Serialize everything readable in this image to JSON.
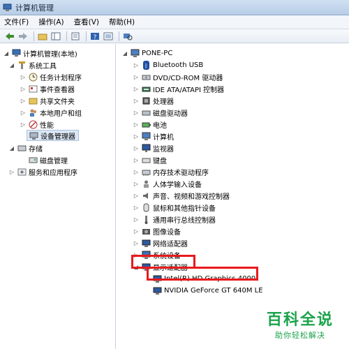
{
  "window": {
    "title": "计算机管理"
  },
  "menu": [
    "文件(F)",
    "操作(A)",
    "查看(V)",
    "帮助(H)"
  ],
  "left_tree": [
    {
      "label": "计算机管理(本地)",
      "level": 0,
      "expanded": true,
      "icon": "computer-management-icon"
    },
    {
      "label": "系统工具",
      "level": 1,
      "expanded": true,
      "icon": "tools-icon"
    },
    {
      "label": "任务计划程序",
      "level": 2,
      "expanded": false,
      "icon": "clock-icon"
    },
    {
      "label": "事件查看器",
      "level": 2,
      "expanded": false,
      "icon": "event-viewer-icon"
    },
    {
      "label": "共享文件夹",
      "level": 2,
      "expanded": false,
      "icon": "shared-folder-icon"
    },
    {
      "label": "本地用户和组",
      "level": 2,
      "expanded": false,
      "icon": "users-icon"
    },
    {
      "label": "性能",
      "level": 2,
      "expanded": false,
      "icon": "performance-icon"
    },
    {
      "label": "设备管理器",
      "level": 2,
      "selected": true,
      "icon": "device-manager-icon"
    },
    {
      "label": "存储",
      "level": 1,
      "expanded": true,
      "icon": "storage-icon"
    },
    {
      "label": "磁盘管理",
      "level": 2,
      "icon": "disk-management-icon"
    },
    {
      "label": "服务和应用程序",
      "level": 1,
      "expanded": false,
      "icon": "services-icon"
    }
  ],
  "right_tree": {
    "root": "PONE-PC",
    "categories": [
      {
        "label": "Bluetooth USB",
        "icon": "bluetooth-icon"
      },
      {
        "label": "DVD/CD-ROM 驱动器",
        "icon": "dvd-icon"
      },
      {
        "label": "IDE ATA/ATAPI 控制器",
        "icon": "ide-icon"
      },
      {
        "label": "处理器",
        "icon": "cpu-icon"
      },
      {
        "label": "磁盘驱动器",
        "icon": "disk-drive-icon"
      },
      {
        "label": "电池",
        "icon": "battery-icon"
      },
      {
        "label": "计算机",
        "icon": "computer-icon"
      },
      {
        "label": "监视器",
        "icon": "monitor-icon"
      },
      {
        "label": "键盘",
        "icon": "keyboard-icon"
      },
      {
        "label": "内存技术驱动程序",
        "icon": "memory-icon"
      },
      {
        "label": "人体学输入设备",
        "icon": "hid-icon"
      },
      {
        "label": "声音、视频和游戏控制器",
        "icon": "sound-icon"
      },
      {
        "label": "鼠标和其他指针设备",
        "icon": "mouse-icon"
      },
      {
        "label": "通用串行总线控制器",
        "icon": "usb-icon"
      },
      {
        "label": "图像设备",
        "icon": "camera-icon"
      },
      {
        "label": "网络适配器",
        "icon": "network-icon"
      },
      {
        "label": "系统设备",
        "icon": "system-device-icon"
      },
      {
        "label": "显示适配器",
        "icon": "display-adapter-icon",
        "expanded": true
      }
    ],
    "display_adapters": [
      {
        "label": "Intel(R) HD Graphics 4000",
        "icon": "display-card-icon"
      },
      {
        "label": "NVIDIA GeForce GT 640M LE",
        "icon": "display-card-icon"
      }
    ]
  },
  "watermark": {
    "title": "百科全说",
    "subtitle": "助你轻松解决"
  },
  "colors": {
    "highlight": "#e8191c",
    "watermark": "#1aa34a",
    "selection": "#dce7f5"
  }
}
